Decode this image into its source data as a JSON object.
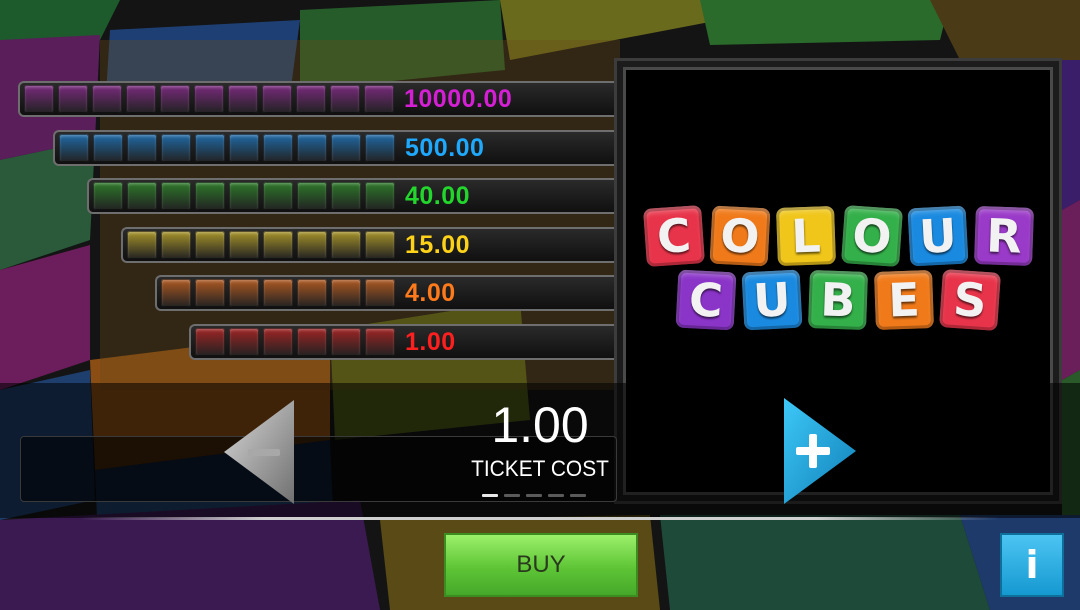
{
  "theme": {
    "tiers": [
      {
        "cubes": 11,
        "prize": "10000.00",
        "color": "#d51fd5",
        "cube_color": "#7a2a7e"
      },
      {
        "cubes": 10,
        "prize": "500.00",
        "color": "#1ea9ff",
        "cube_color": "#1f6aa8"
      },
      {
        "cubes": 9,
        "prize": "40.00",
        "color": "#22d62c",
        "cube_color": "#2e7a2a"
      },
      {
        "cubes": 8,
        "prize": "15.00",
        "color": "#ffd21a",
        "cube_color": "#a8952a"
      },
      {
        "cubes": 7,
        "prize": "4.00",
        "color": "#ff7a1a",
        "cube_color": "#b05a22"
      },
      {
        "cubes": 6,
        "prize": "1.00",
        "color": "#ff1f1f",
        "cube_color": "#a02424"
      }
    ]
  },
  "logo": {
    "row1": [
      {
        "letter": "C",
        "color": "#e8344a"
      },
      {
        "letter": "O",
        "color": "#f07a1a"
      },
      {
        "letter": "L",
        "color": "#f0c61a"
      },
      {
        "letter": "O",
        "color": "#34b04a"
      },
      {
        "letter": "U",
        "color": "#1a8ae0"
      },
      {
        "letter": "R",
        "color": "#9a3ac8"
      }
    ],
    "row2": [
      {
        "letter": "C",
        "color": "#8a34c8"
      },
      {
        "letter": "U",
        "color": "#1a8ae0"
      },
      {
        "letter": "B",
        "color": "#34b04a"
      },
      {
        "letter": "E",
        "color": "#f07a1a"
      },
      {
        "letter": "S",
        "color": "#e8344a"
      }
    ]
  },
  "ticket": {
    "cost": "1.00",
    "label": "TICKET COST",
    "dots_total": 5,
    "dots_active": 1
  },
  "buttons": {
    "buy": "BUY",
    "info": "i",
    "minus_icon": "minus-arrow-icon",
    "plus_icon": "plus-arrow-icon"
  }
}
